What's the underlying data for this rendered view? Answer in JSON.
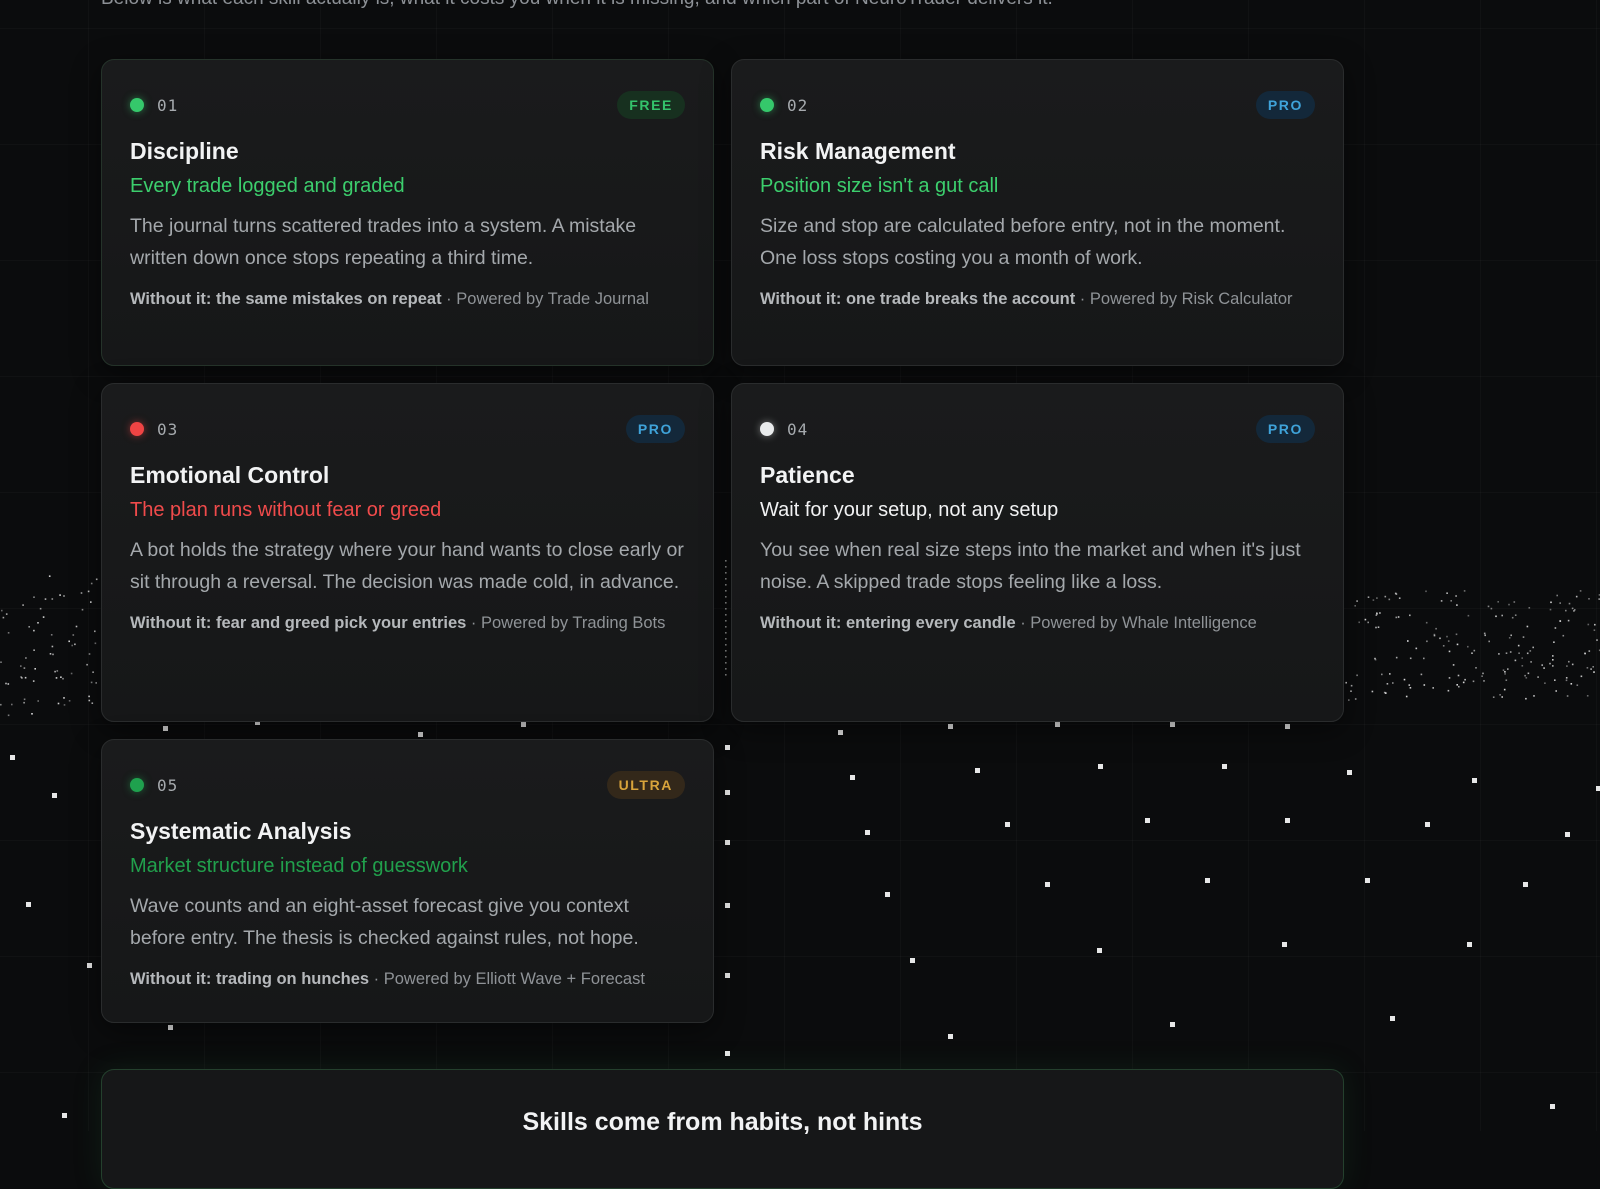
{
  "intro": {
    "text": "Below is what each skill actually is, what it costs you when it is missing, and which part of NeuroTrader delivers it."
  },
  "colors": {
    "green": "#35c86b",
    "red": "#ef4444",
    "white": "#e9ebec",
    "dark_green": "#1fa14e",
    "tag_green": "#3ccf6d",
    "tag_red": "#f04b4b",
    "tag_white": "#f1f2f3",
    "tag_dark_green": "#21a04c"
  },
  "cards": [
    {
      "number": "01",
      "badge": "FREE",
      "title": "Discipline",
      "tagline": "Every trade logged and graded",
      "description": "The journal turns scattered trades into a system. A mistake written down once stops repeating a third time.",
      "without": "Without it: the same mistakes on repeat",
      "powered": " · Powered by Trade Journal"
    },
    {
      "number": "02",
      "badge": "PRO",
      "title": "Risk Management",
      "tagline": "Position size isn't a gut call",
      "description": "Size and stop are calculated before entry, not in the moment. One loss stops costing you a month of work.",
      "without": "Without it: one trade breaks the account",
      "powered": " · Powered by Risk Calculator"
    },
    {
      "number": "03",
      "badge": "PRO",
      "title": "Emotional Control",
      "tagline": "The plan runs without fear or greed",
      "description": "A bot holds the strategy where your hand wants to close early or sit through a reversal. The decision was made cold, in advance.",
      "without": "Without it: fear and greed pick your entries",
      "powered": " · Powered by Trading Bots"
    },
    {
      "number": "04",
      "badge": "PRO",
      "title": "Patience",
      "tagline": "Wait for your setup, not any setup",
      "description": "You see when real size steps into the market and when it's just noise. A skipped trade stops feeling like a loss.",
      "without": "Without it: entering every candle",
      "powered": " · Powered by Whale Intelligence"
    },
    {
      "number": "05",
      "badge": "ULTRA",
      "title": "Systematic Analysis",
      "tagline": "Market structure instead of guesswork",
      "description": "Wave counts and an eight-asset forecast give you context before entry. The thesis is checked against rules, not hope.",
      "without": "Without it: trading on hunches",
      "powered": " · Powered by Elliott Wave + Forecast"
    }
  ],
  "cta": {
    "title": "Skills come from habits, not hints"
  }
}
